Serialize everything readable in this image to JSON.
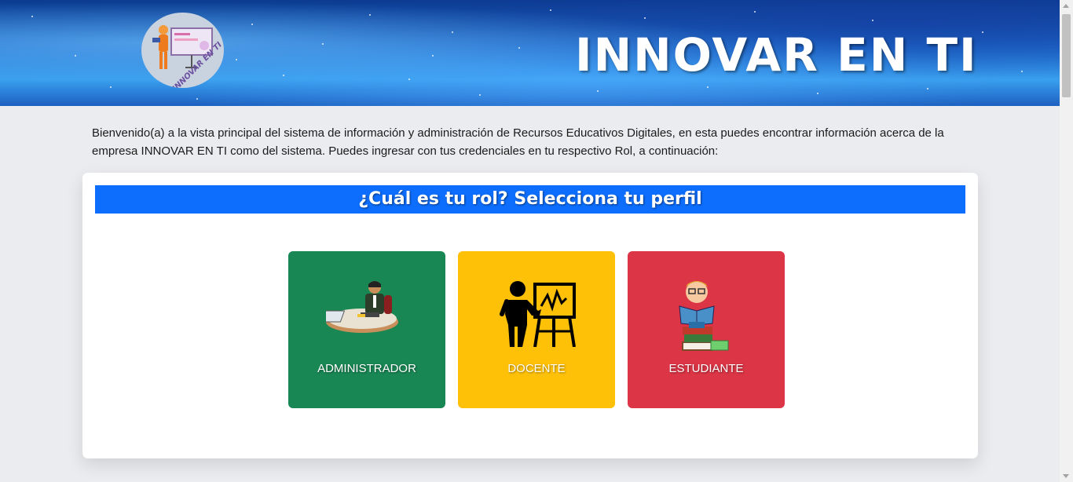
{
  "header": {
    "title": "INNOVAR EN TI",
    "logo_text": "INNOVAR EN TI"
  },
  "intro": {
    "text": "Bienvenido(a) a la vista principal del sistema de información y administración de Recursos Educativos Digitales, en esta puedes encontrar información acerca de la empresa INNOVAR EN TI como del sistema. Puedes ingresar con tus credenciales en tu respectivo Rol, a continuación:"
  },
  "roles": {
    "title": "¿Cuál es tu rol? Selecciona tu perfil",
    "items": [
      {
        "label": "ADMINISTRADOR",
        "icon": "administrator-icon",
        "color": "#198754"
      },
      {
        "label": "DOCENTE",
        "icon": "teacher-icon",
        "color": "#ffc107"
      },
      {
        "label": "ESTUDIANTE",
        "icon": "student-icon",
        "color": "#dc3545"
      }
    ]
  },
  "colors": {
    "page_bg": "#ebecef",
    "primary": "#0d6efd"
  }
}
